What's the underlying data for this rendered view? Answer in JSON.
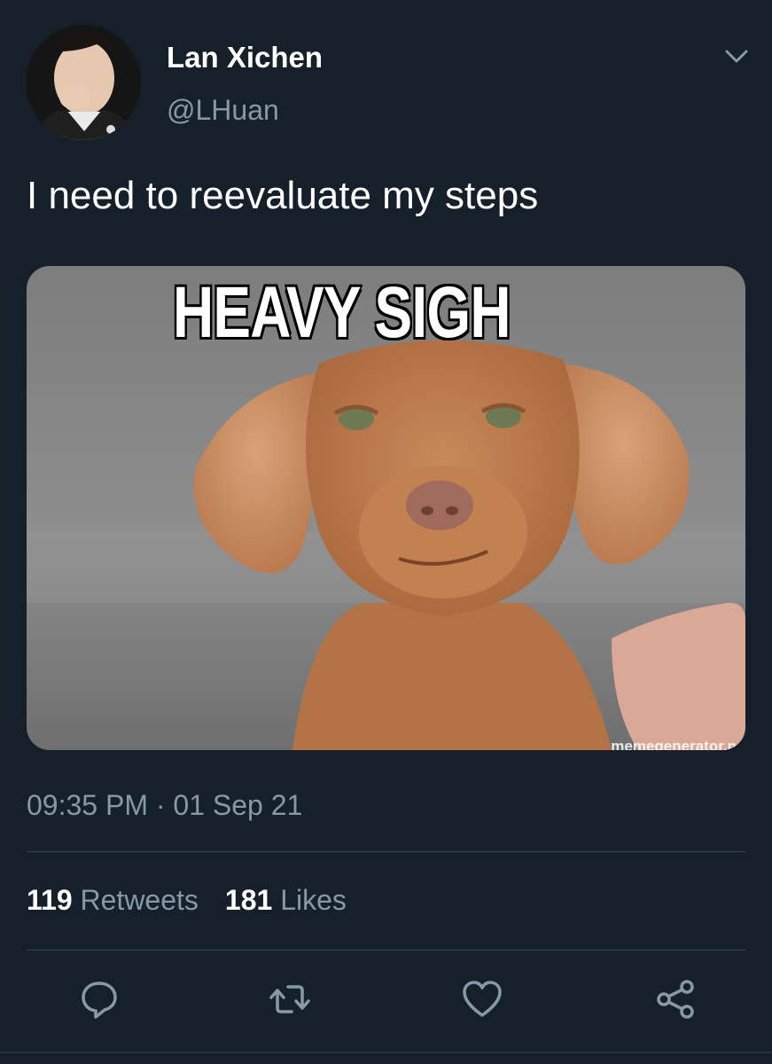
{
  "author": {
    "name": "Lan Xichen",
    "handle": "@LHuan",
    "avatar_icon": "profile-photo"
  },
  "tweet": {
    "text": "I need to reevaluate my steps",
    "timestamp": "09:35 PM · 01 Sep 21"
  },
  "media": {
    "caption": "HEAVY SIGH",
    "watermark": "memegenerator.n"
  },
  "stats": {
    "retweets_count": "119",
    "retweets_label": "Retweets",
    "likes_count": "181",
    "likes_label": "Likes"
  },
  "actions": {
    "reply_icon": "reply-icon",
    "retweet_icon": "retweet-icon",
    "like_icon": "heart-icon",
    "share_icon": "share-icon"
  },
  "colors": {
    "background": "#15202b",
    "secondary_text": "#8899a6",
    "divider": "#38444d"
  }
}
